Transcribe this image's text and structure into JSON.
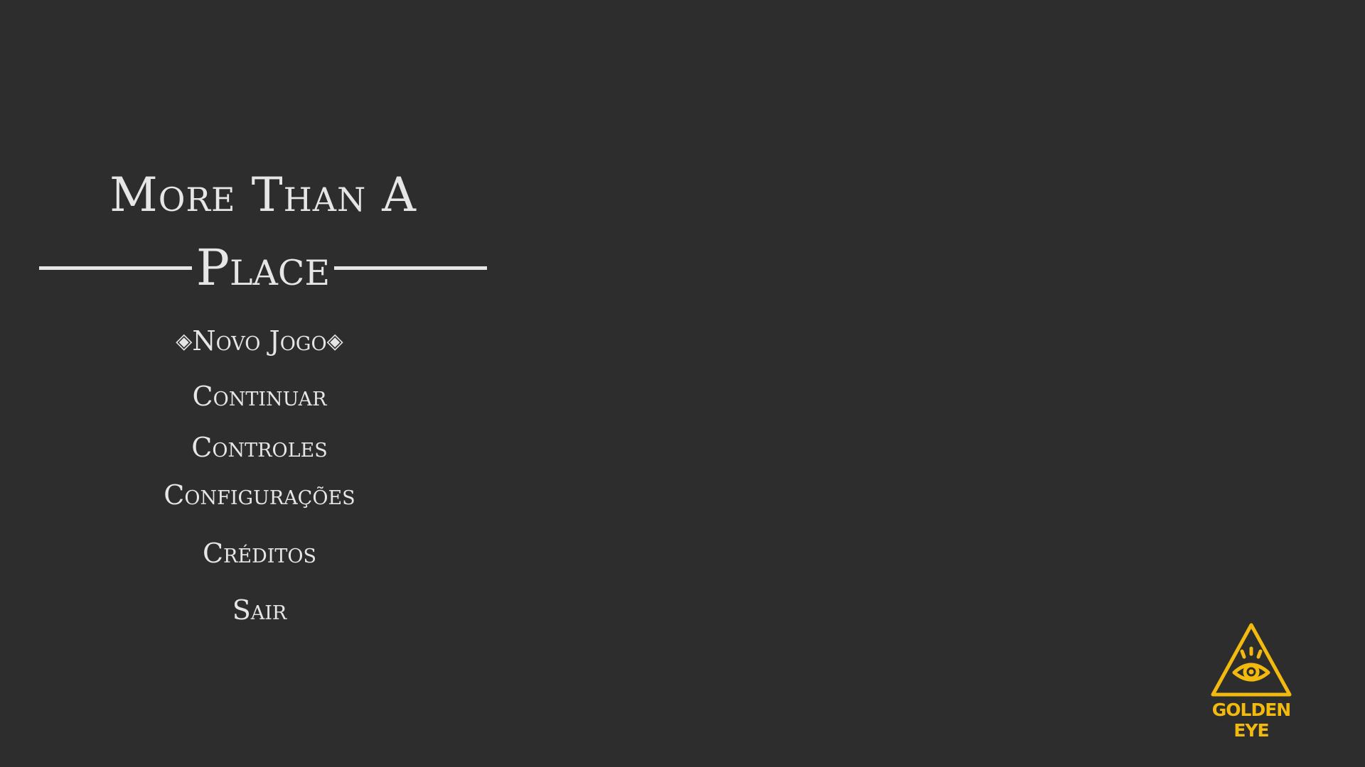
{
  "game": {
    "title_line1": "More Than A",
    "title_line2": "Place"
  },
  "menu": {
    "selector_icon": "diamond-icon",
    "items": [
      {
        "label": "Novo Jogo",
        "selected": true
      },
      {
        "label": "Continuar",
        "selected": false
      },
      {
        "label": "Controles",
        "selected": false
      },
      {
        "label": "Configurações",
        "selected": false
      },
      {
        "label": "Créditos",
        "selected": false
      },
      {
        "label": "Sair",
        "selected": false
      }
    ]
  },
  "studio": {
    "name": "GOLDEN EYE",
    "icon": "eye-in-triangle-icon",
    "color": "#f2b90f"
  },
  "colors": {
    "background": "#2d2d2d",
    "text": "#e6e6e6"
  }
}
